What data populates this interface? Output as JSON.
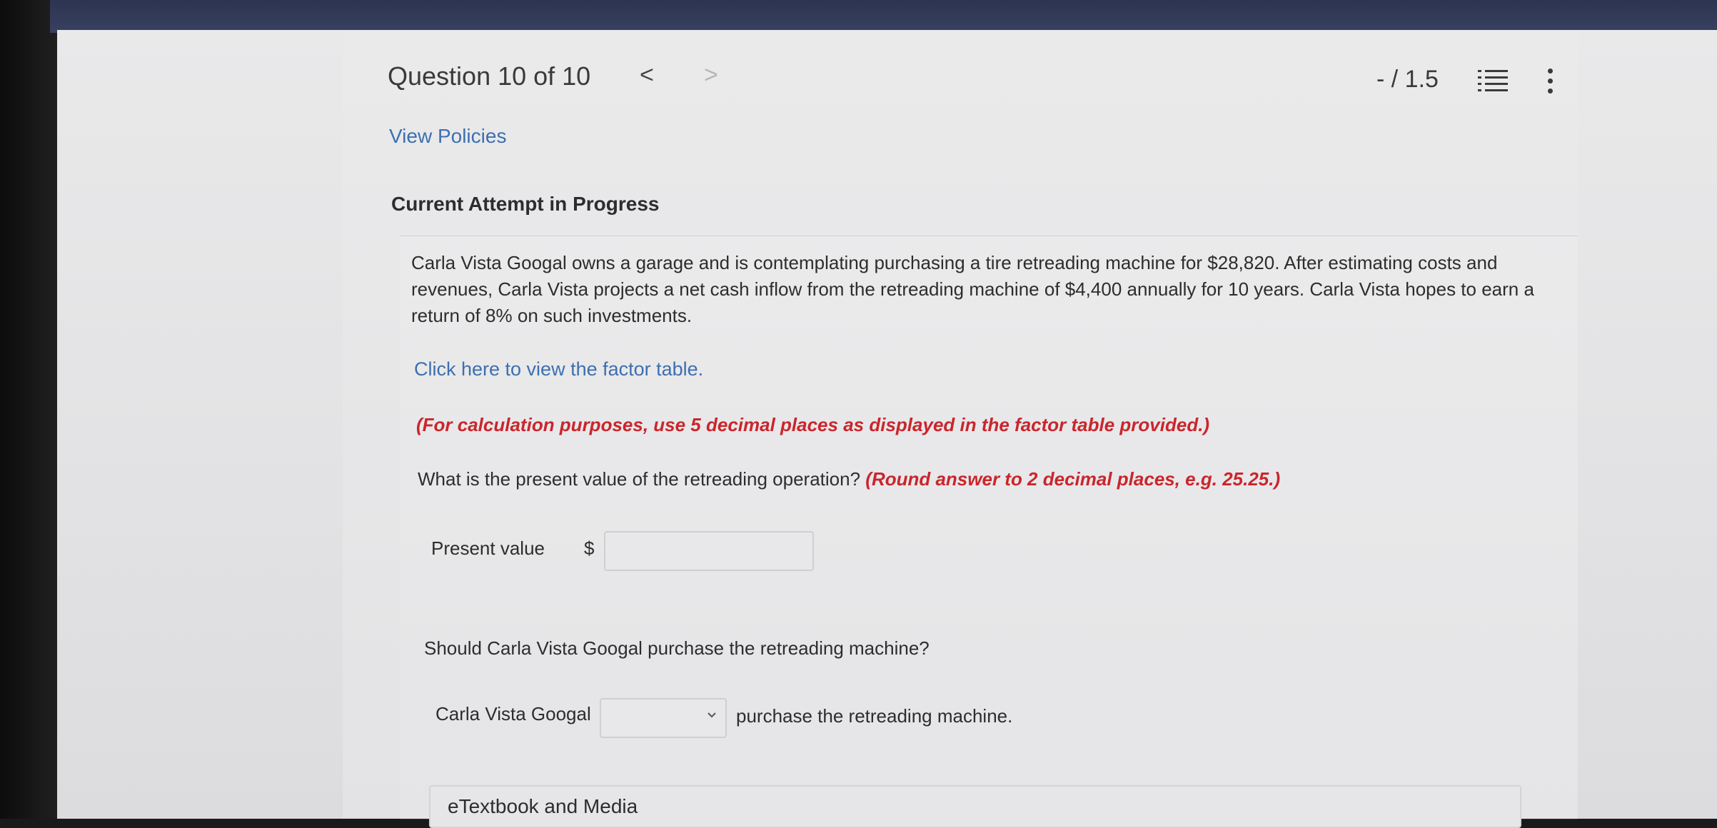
{
  "header": {
    "question_label": "Question 10 of 10",
    "prev_icon": "<",
    "next_icon": ">",
    "score": "- / 1.5"
  },
  "links": {
    "view_policies": "View Policies",
    "factor_table": "Click here to view the factor table."
  },
  "attempt_status": "Current Attempt in Progress",
  "problem": {
    "text": "Carla Vista Googal owns a garage and is contemplating purchasing a tire retreading machine for $28,820. After estimating costs and revenues, Carla Vista projects a net cash inflow from the retreading machine of $4,400 annually for 10 years. Carla Vista hopes to earn a return of 8% on such investments.",
    "calculation_note": "(For calculation purposes, use 5 decimal places as displayed in the factor table provided.)",
    "question": "What is the present value of the retreading operation? ",
    "question_hint": "(Round answer to 2 decimal places, e.g. 25.25.)"
  },
  "present_value": {
    "label": "Present value",
    "currency": "$",
    "value": ""
  },
  "decision": {
    "question": "Should Carla Vista Googal purchase the retreading machine?",
    "label": "Carla Vista Googal",
    "selected": "",
    "suffix": "purchase the retreading machine."
  },
  "etextbook": "eTextbook and Media",
  "icons": {
    "list": "list-icon",
    "more": "more-vertical-icon",
    "chevron": "chevron-down-icon"
  },
  "colors": {
    "link": "#3d6fb0",
    "note_red": "#c9262c",
    "topbar": "#2c3450"
  }
}
